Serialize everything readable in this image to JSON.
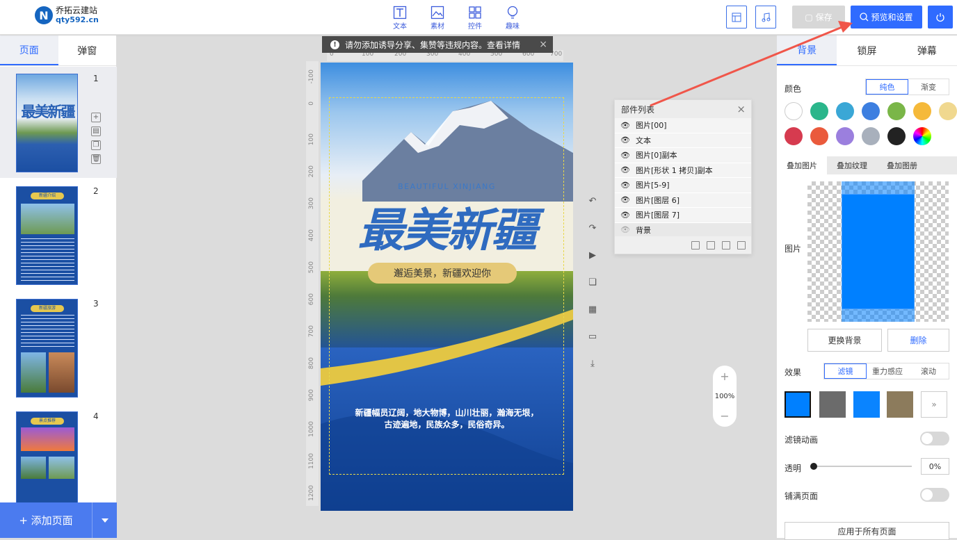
{
  "brand": {
    "name": "乔拓云建站",
    "url": "qty592.cn",
    "mark": "N"
  },
  "toolbar": {
    "tools": [
      {
        "label": "文本",
        "icon": "text-icon"
      },
      {
        "label": "素材",
        "icon": "image-icon"
      },
      {
        "label": "控件",
        "icon": "widget-icon"
      },
      {
        "label": "趣味",
        "icon": "bulb-icon"
      }
    ],
    "save_label": "保存",
    "preview_label": "预览和设置"
  },
  "left": {
    "tabs": [
      "页面",
      "弹窗"
    ],
    "active_tab": "页面",
    "pages": [
      "1",
      "2",
      "3",
      "4"
    ],
    "thumb_titles": {
      "p1": "最美新疆",
      "p2": "新疆介绍",
      "p3": "新疆旅游",
      "p4": "景点推荐"
    },
    "add_label": "+ 添加页面"
  },
  "notice": {
    "text": "请勿添加诱导分享、集赞等违规内容。查看详情"
  },
  "ruler": {
    "h": [
      "0",
      "100",
      "200",
      "300",
      "400",
      "500",
      "600",
      "700"
    ],
    "v": [
      "-100",
      "0",
      "100",
      "200",
      "300",
      "400",
      "500",
      "600",
      "700",
      "800",
      "900",
      "1000",
      "1100",
      "1200"
    ]
  },
  "canvas": {
    "subtitle_en": "BEAUTIFUL XINJIANG",
    "title_cn": "最美新疆",
    "pill": "邂逅美景，新疆欢迎你",
    "body_line1": "新疆幅员辽阔，地大物博，山川壮丽，瀚海无垠，",
    "body_line2": "古迹遍地，民族众多，民俗奇异。"
  },
  "layers": {
    "title": "部件列表",
    "items": [
      {
        "name": "图片[00]",
        "visible": true
      },
      {
        "name": "文本",
        "visible": true
      },
      {
        "name": "图片[0]副本",
        "visible": true
      },
      {
        "name": "图片[形状 1 拷贝]副本",
        "visible": true
      },
      {
        "name": "图片[5-9]",
        "visible": true
      },
      {
        "name": "图片[图层 6]",
        "visible": true
      },
      {
        "name": "图片[图层 7]",
        "visible": true
      },
      {
        "name": "背景",
        "visible": false
      }
    ]
  },
  "zoom": {
    "value": "100%"
  },
  "right": {
    "tabs": [
      "背景",
      "锁屏",
      "弹幕"
    ],
    "active_tab": "背景",
    "color_label": "颜色",
    "color_modes": [
      "纯色",
      "渐变"
    ],
    "color_mode_active": "纯色",
    "swatches": [
      "#ffffff",
      "#2bb68b",
      "#3aa7d6",
      "#3d7fe0",
      "#7ab648",
      "#f5b93a",
      "#f0d88f",
      "#f07f86",
      "#d63b4f",
      "#ea5a3c",
      "#9b7fde",
      "#a8b0bc",
      "#222222",
      "rainbow"
    ],
    "overlay_tabs": [
      "叠加图片",
      "叠加纹理",
      "叠加图册"
    ],
    "overlay_active": "叠加图片",
    "image_label": "图片",
    "replace_label": "更换背景",
    "delete_label": "删除",
    "effect_label": "效果",
    "effect_modes": [
      "滤镜",
      "重力感应",
      "滚动"
    ],
    "effect_active": "滤镜",
    "filter_colors": [
      "#0080ff",
      "#6b6b6b",
      "#0a84ff",
      "#8c7b5c"
    ],
    "filter_anim_label": "滤镜动画",
    "opacity_label": "透明",
    "opacity_value": "0%",
    "fill_label": "铺满页面",
    "apply_label": "应用于所有页面"
  }
}
